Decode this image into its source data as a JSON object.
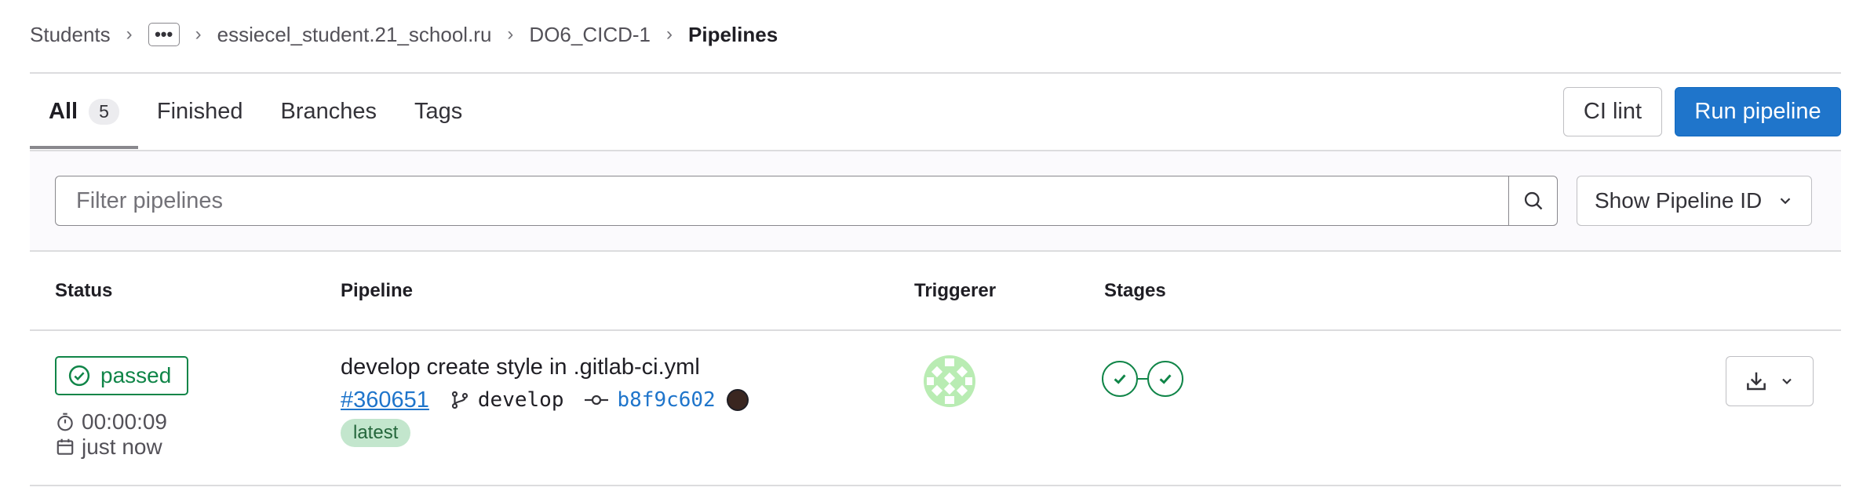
{
  "breadcrumb": {
    "items": [
      "Students",
      "essiecel_student.21_school.ru",
      "DO6_CICD-1"
    ],
    "more": "•••",
    "current": "Pipelines"
  },
  "tabs": [
    {
      "label": "All",
      "count": "5"
    },
    {
      "label": "Finished"
    },
    {
      "label": "Branches"
    },
    {
      "label": "Tags"
    }
  ],
  "actions": {
    "ci_lint": "CI lint",
    "run_pipeline": "Run pipeline"
  },
  "filter": {
    "placeholder": "Filter pipelines",
    "show_id": "Show Pipeline ID"
  },
  "table": {
    "headers": [
      "Status",
      "Pipeline",
      "Triggerer",
      "Stages"
    ],
    "rows": [
      {
        "status": "passed",
        "duration": "00:00:09",
        "finished": "just now",
        "commit_title": "develop create style in .gitlab-ci.yml",
        "pipeline_id": "#360651",
        "ref": "develop",
        "sha": "b8f9c602",
        "badge": "latest",
        "stages": [
          "passed",
          "passed"
        ]
      }
    ]
  },
  "colors": {
    "primary": "#1f75cb",
    "success": "#108548",
    "latest_bg": "#c3e6cd"
  },
  "icons": [
    "chevron-right-icon",
    "ellipsis-icon",
    "search-icon",
    "chevron-down-icon",
    "status-success-icon",
    "timer-icon",
    "calendar-icon",
    "branch-icon",
    "commit-icon",
    "download-icon"
  ]
}
